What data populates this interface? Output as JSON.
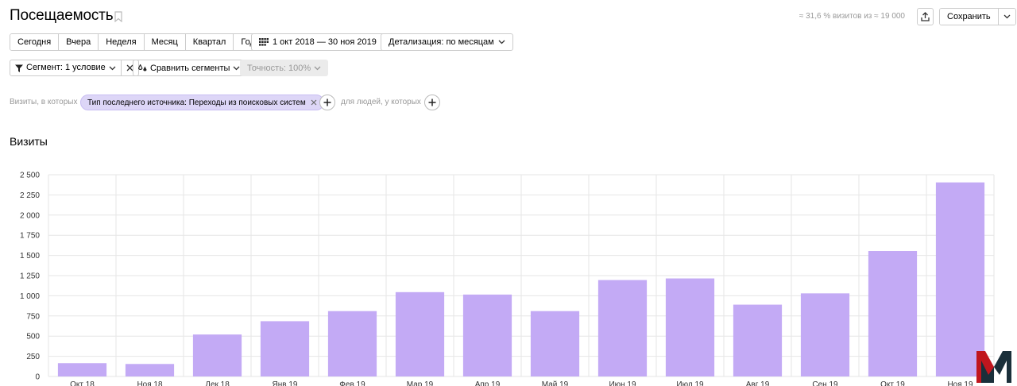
{
  "header": {
    "title": "Посещаемость",
    "sample_info": "≈ 31,6 % визитов из ≈ 19 000",
    "save_label": "Сохранить"
  },
  "periods": [
    "Сегодня",
    "Вчера",
    "Неделя",
    "Месяц",
    "Квартал",
    "Год"
  ],
  "date_range": "1 окт 2018 — 30 ноя 2019",
  "detail": "Детализация: по месяцам",
  "segment": {
    "label": "Сегмент: 1 условие",
    "compare_label": "Сравнить сегменты",
    "accuracy_label": "Точность: 100%"
  },
  "filter": {
    "visits_prefix": "Визиты, в которых",
    "chip_label": "Тип последнего источника: Переходы из поисковых систем",
    "people_prefix": "для людей, у которых"
  },
  "colors": {
    "bar": "#c3aaf5",
    "chip": "#ddd6f7",
    "grid": "#e6e6e6"
  },
  "chart_data": {
    "type": "bar",
    "title": "Визиты",
    "categories": [
      "Окт 18",
      "Ноя 18",
      "Дек 18",
      "Янв 19",
      "Фев 19",
      "Мар 19",
      "Апр 19",
      "Май 19",
      "Июн 19",
      "Июл 19",
      "Авг 19",
      "Сен 19",
      "Окт 19",
      "Ноя 19"
    ],
    "values": [
      165,
      155,
      520,
      685,
      810,
      1045,
      1015,
      810,
      1195,
      1215,
      890,
      1030,
      1555,
      2405
    ],
    "ylim": [
      0,
      2500
    ],
    "yticks": [
      0,
      250,
      500,
      750,
      1000,
      1250,
      1500,
      1750,
      2000,
      2250,
      2500
    ],
    "ytick_labels": [
      "0",
      "250",
      "500",
      "750",
      "1 000",
      "1 250",
      "1 500",
      "1 750",
      "2 000",
      "2 250",
      "2 500"
    ],
    "grid": true
  }
}
